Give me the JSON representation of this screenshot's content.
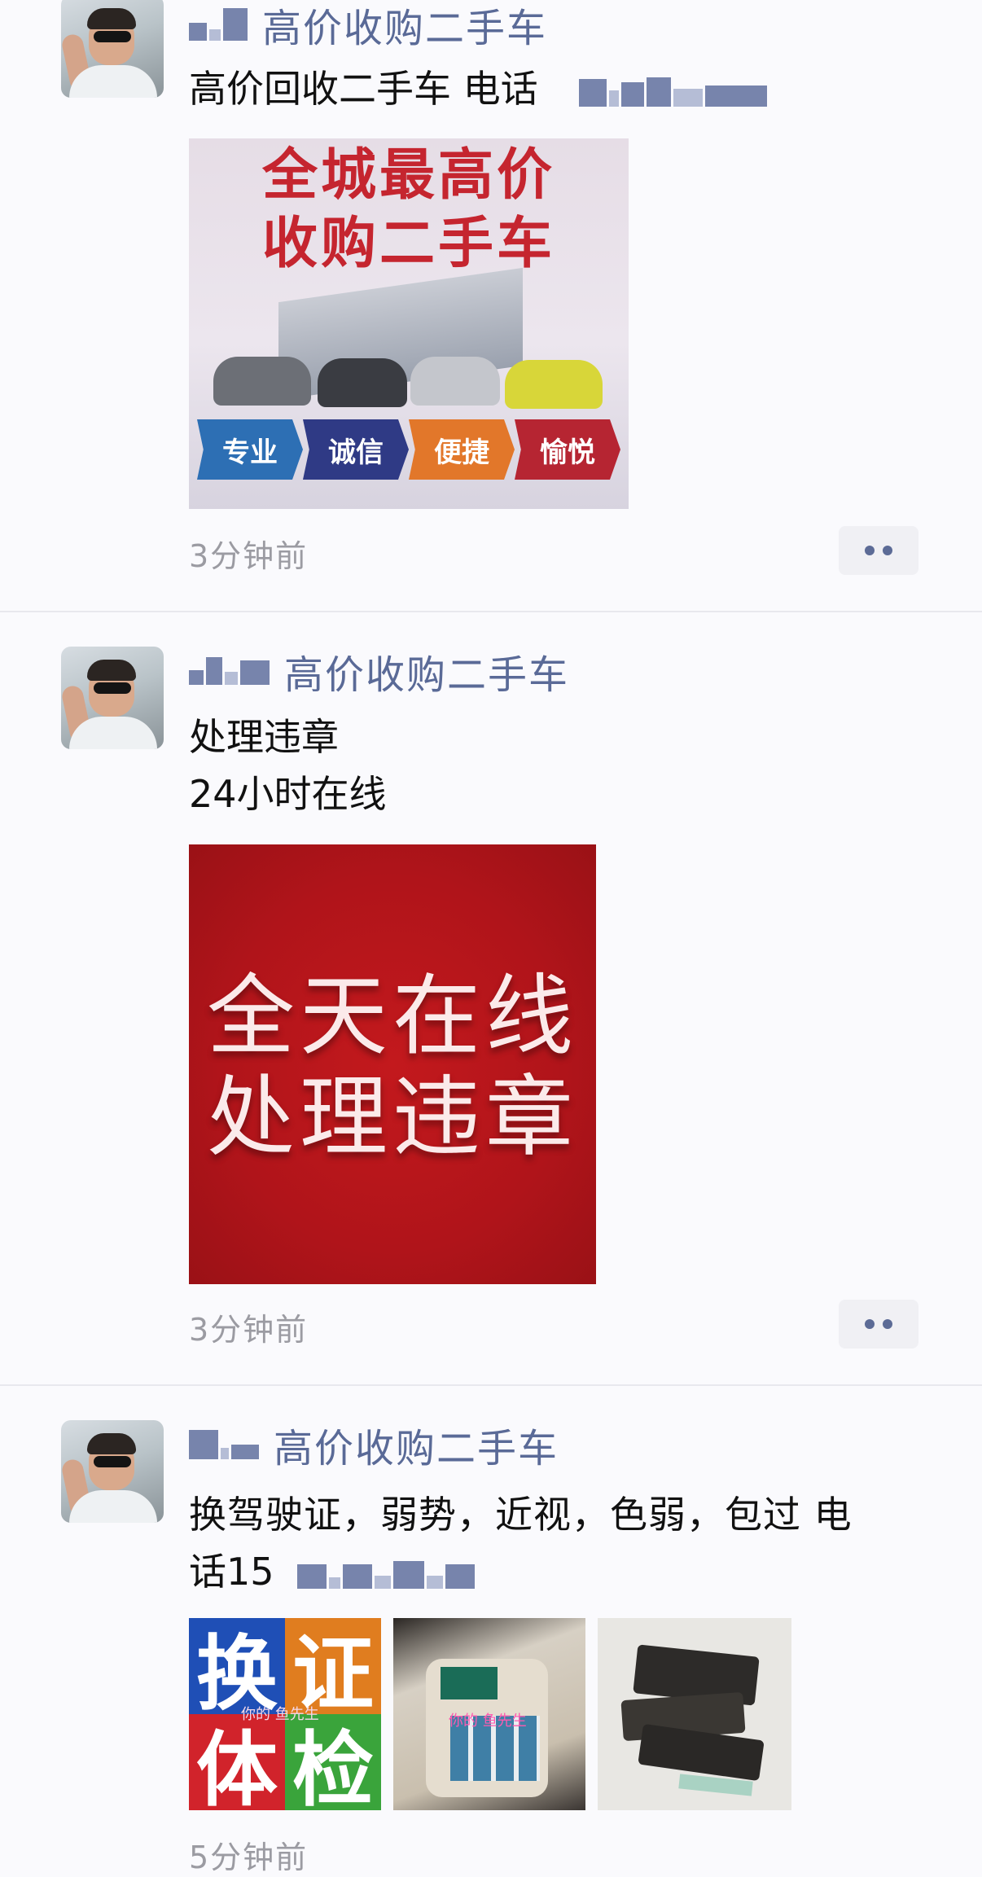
{
  "posts": [
    {
      "name": "高价收购二手车",
      "text_lines": [
        "高价回收二手车 电话"
      ],
      "image_text": {
        "line1": "全城最高价",
        "line2": "收购二手车",
        "tags": [
          "专业",
          "诚信",
          "便捷",
          "愉悦"
        ]
      },
      "time": "3分钟前"
    },
    {
      "name": "高价收购二手车",
      "text_lines": [
        "处理违章",
        "24小时在线"
      ],
      "image_text": {
        "line1": "全天在线",
        "line2": "处理违章"
      },
      "time": "3分钟前"
    },
    {
      "name": "高价收购二手车",
      "text_lines": [
        "换驾驶证，弱势，近视，色弱，包过 电",
        "话15"
      ],
      "tiles": [
        "换",
        "证",
        "体",
        "检"
      ],
      "watermark": "你的 鱼先生",
      "watermark2": "你的 鱼先生",
      "time": "5分钟前"
    }
  ],
  "colors": {
    "name": "#5a6a97",
    "time": "#9b9ba2",
    "tile_blue": "#1f4fb6",
    "tile_orange": "#e07d1f",
    "tile_red": "#d1232b",
    "tile_green": "#3aa43b"
  }
}
